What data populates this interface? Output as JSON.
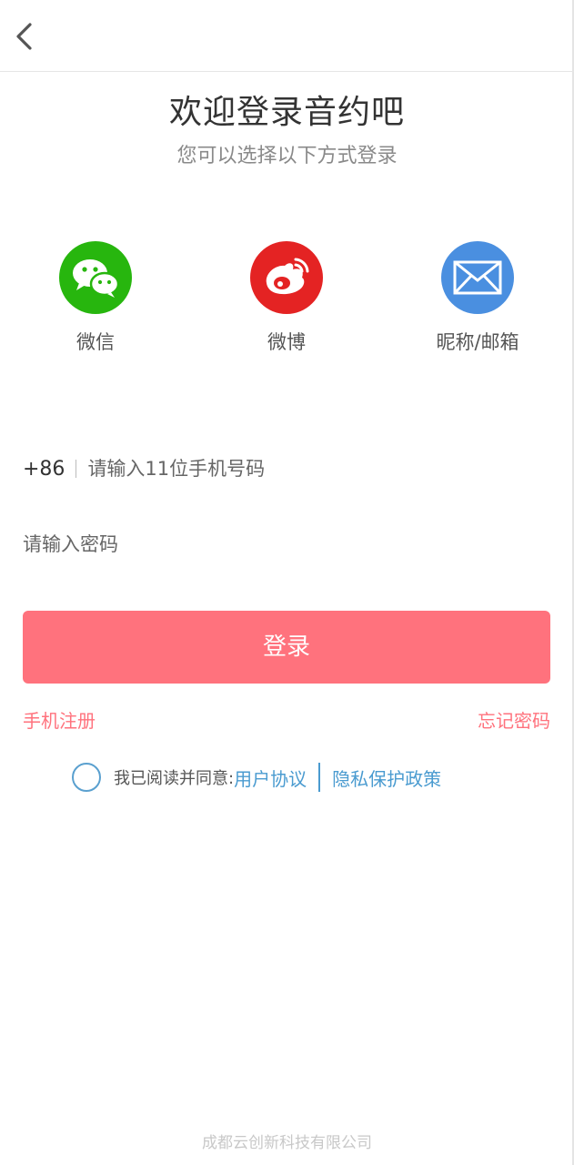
{
  "header": {
    "back_icon": "chevron-left-icon"
  },
  "title": "欢迎登录音约吧",
  "subtitle": "您可以选择以下方式登录",
  "social": [
    {
      "label": "微信",
      "icon": "wechat-icon",
      "color": "#27b60e"
    },
    {
      "label": "微博",
      "icon": "weibo-icon",
      "color": "#e42323"
    },
    {
      "label": "昵称/邮箱",
      "icon": "mail-icon",
      "color": "#4a8fe0"
    }
  ],
  "phone": {
    "country_code": "+86",
    "placeholder": "请输入11位手机号码",
    "value": ""
  },
  "password": {
    "placeholder": "请输入密码",
    "value": ""
  },
  "login_button": "登录",
  "links": {
    "register": "手机注册",
    "forgot": "忘记密码"
  },
  "agreement": {
    "prefix": "我已阅读并同意:",
    "user_agreement": "用户协议",
    "privacy_policy": "隐私保护政策",
    "checked": false
  },
  "footer": "成都云创新科技有限公司",
  "colors": {
    "accent": "#ff727d",
    "link": "#4a9bd0"
  }
}
